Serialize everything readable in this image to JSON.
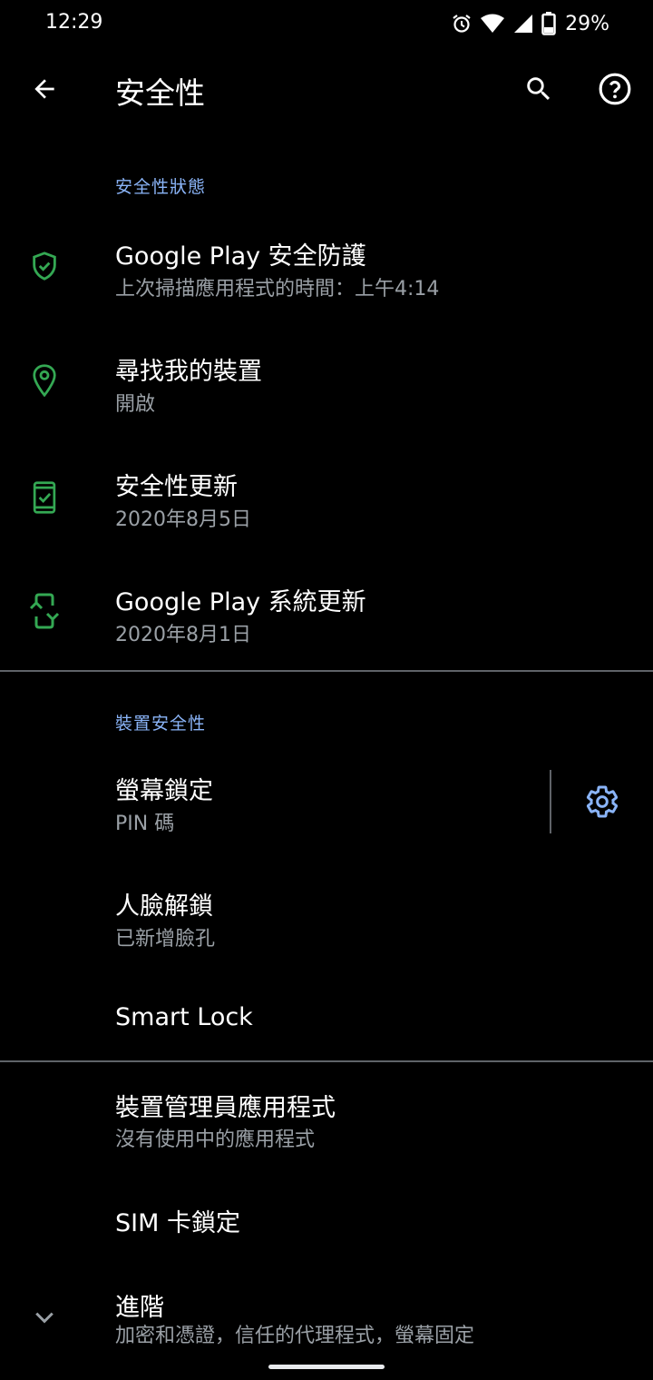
{
  "status_bar": {
    "time": "12:29",
    "battery": "29%",
    "icons": [
      "alarm-icon",
      "wifi-icon",
      "cell-signal-icon",
      "battery-icon"
    ]
  },
  "app_bar": {
    "title": "安全性",
    "back_icon": "arrow-back-icon",
    "search_icon": "search-icon",
    "help_icon": "help-icon"
  },
  "sections": {
    "security_status": "安全性狀態",
    "device_security": "裝置安全性"
  },
  "items": {
    "play_protect": {
      "title": "Google Play 安全防護",
      "summary": "上次掃描應用程式的時間：上午4:14",
      "icon": "shield-check-icon"
    },
    "find_device": {
      "title": "尋找我的裝置",
      "summary": "開啟",
      "icon": "location-pin-icon"
    },
    "security_update": {
      "title": "安全性更新",
      "summary": "2020年8月5日",
      "icon": "phone-check-icon"
    },
    "play_system_update": {
      "title": "Google Play 系統更新",
      "summary": "2020年8月1日",
      "icon": "phone-update-icon"
    },
    "screen_lock": {
      "title": "螢幕鎖定",
      "summary": "PIN 碼",
      "settings_icon": "gear-icon"
    },
    "face_unlock": {
      "title": "人臉解鎖",
      "summary": "已新增臉孔"
    },
    "smart_lock": {
      "title": "Smart Lock"
    },
    "device_admin": {
      "title": "裝置管理員應用程式",
      "summary": "沒有使用中的應用程式"
    },
    "sim_lock": {
      "title": "SIM 卡鎖定"
    },
    "advanced": {
      "title": "進階",
      "summary": "加密和憑證，信任的代理程式，螢幕固定",
      "icon": "chevron-down-icon"
    }
  },
  "colors": {
    "accent": "#8ab4f8",
    "icon_green": "#34a853",
    "background": "#000000"
  }
}
